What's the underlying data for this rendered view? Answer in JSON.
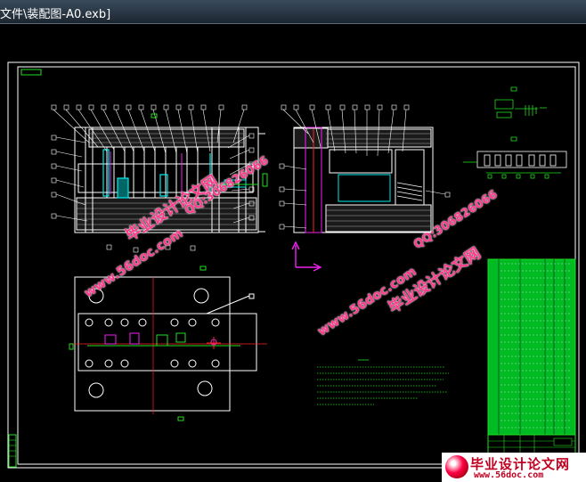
{
  "window": {
    "title": "文件\\装配图-A0.exb]"
  },
  "watermarks": {
    "w1_site": "www.56doc.com",
    "w1_name": "毕业设计论文网",
    "w1_qq": "QQ:306826066",
    "w2_site": "www.56doc.com",
    "w2_name": "毕业设计论文网",
    "w2_qq": "QQ:306826066"
  },
  "logo": {
    "name": "毕业设计论文网",
    "url": "www.56doc.com"
  },
  "colors": {
    "background": "#000000",
    "frame": "#ffffff",
    "drawing": "#ffffff",
    "green": "#22dd22",
    "cyan": "#00e0e0",
    "magenta": "#e020e0",
    "red": "#ff2020",
    "watermark": "#ff3a8c"
  },
  "icons": {
    "ucs": "ucs-axis-icon",
    "logo": "logo-ball-icon"
  }
}
